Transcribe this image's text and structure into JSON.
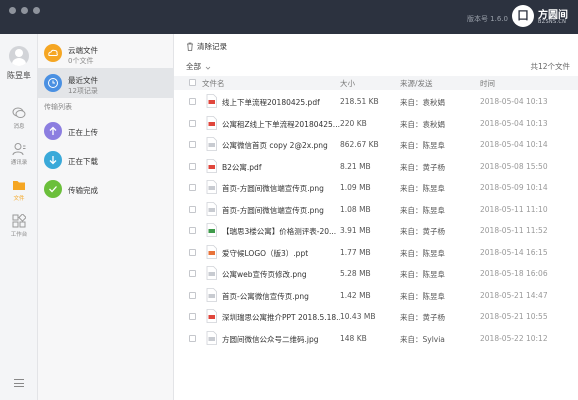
{
  "header": {
    "version": "版本号 1.6.0",
    "logo_mark": "囗",
    "logo_text": "方圆间",
    "logo_sub": "BZSNS.CN"
  },
  "user": {
    "name": "陈昱阜"
  },
  "nav": [
    {
      "label": "消息",
      "icon": "chat-icon"
    },
    {
      "label": "通讯录",
      "icon": "contacts-icon"
    },
    {
      "label": "文件",
      "icon": "folder-icon",
      "active": true
    },
    {
      "label": "工作台",
      "icon": "workbench-icon"
    }
  ],
  "side": {
    "cloud": {
      "title": "云端文件",
      "sub": "0个文件"
    },
    "recent": {
      "title": "最近文件",
      "sub": "12项记录"
    },
    "transfer_label": "传输列表",
    "uploading": "正在上传",
    "downloading": "正在下载",
    "done": "传输完成"
  },
  "toolbar": {
    "clear": "清除记录"
  },
  "filter": {
    "value": "全部",
    "count": "共12个文件"
  },
  "columns": {
    "name": "文件名",
    "size": "大小",
    "source": "来源/发送",
    "time": "时间"
  },
  "files": [
    {
      "type": "pdf",
      "name": "线上下单流程20180425.pdf",
      "size": "218.51 KB",
      "source": "来自：袁秋娟",
      "time": "2018-05-04 10:13"
    },
    {
      "type": "pdf",
      "name": "公寓租Z线上下单流程20180425....",
      "size": "220 KB",
      "source": "来自：袁秋娟",
      "time": "2018-05-04 10:13"
    },
    {
      "type": "img",
      "name": "公寓微信首页 copy 2@2x.png",
      "size": "862.67 KB",
      "source": "来自：陈昱阜",
      "time": "2018-05-04 10:14"
    },
    {
      "type": "pdf",
      "name": "B2公寓.pdf",
      "size": "8.21 MB",
      "source": "来自：黄子杨",
      "time": "2018-05-08 15:50"
    },
    {
      "type": "img",
      "name": "首页-方圆间微信端宣传页.png",
      "size": "1.09 MB",
      "source": "来自：陈昱阜",
      "time": "2018-05-09 10:14"
    },
    {
      "type": "img",
      "name": "首页-方圆间微信端宣传页.png",
      "size": "1.08 MB",
      "source": "来自：陈昱阜",
      "time": "2018-05-11 11:10"
    },
    {
      "type": "xls",
      "name": "【瑞思3楼公寓】价格测评表-20...",
      "size": "3.91 MB",
      "source": "来自：黄子杨",
      "time": "2018-05-11 11:52"
    },
    {
      "type": "ppt",
      "name": "爱守候LOGO（版3）.ppt",
      "size": "1.77 MB",
      "source": "来自：陈昱阜",
      "time": "2018-05-14 16:15"
    },
    {
      "type": "img",
      "name": "公寓web宣传页修改.png",
      "size": "5.28 MB",
      "source": "来自：陈昱阜",
      "time": "2018-05-18 16:06"
    },
    {
      "type": "img",
      "name": "首页-公寓微信宣传页.png",
      "size": "1.42 MB",
      "source": "来自：陈昱阜",
      "time": "2018-05-21 14:47"
    },
    {
      "type": "pdf",
      "name": "深圳瑞思公寓推介PPT 2018.5.18...",
      "size": "10.43 MB",
      "source": "来自：黄子杨",
      "time": "2018-05-21 10:55"
    },
    {
      "type": "img",
      "name": "方圆间微信公众号二维码.jpg",
      "size": "148 KB",
      "source": "来自：Sylvia",
      "time": "2018-05-22 10:12"
    }
  ],
  "colors": {
    "titlebar": "#2c323f",
    "cloud": "#f5a623",
    "recent": "#4a90e2",
    "upload": "#8c7ee0",
    "download": "#3aa9d9",
    "done": "#6bbf3b",
    "pdf": "#e0463c",
    "xls": "#3f9b4b",
    "ppt": "#e8733a",
    "img": "#c8cbd1"
  }
}
